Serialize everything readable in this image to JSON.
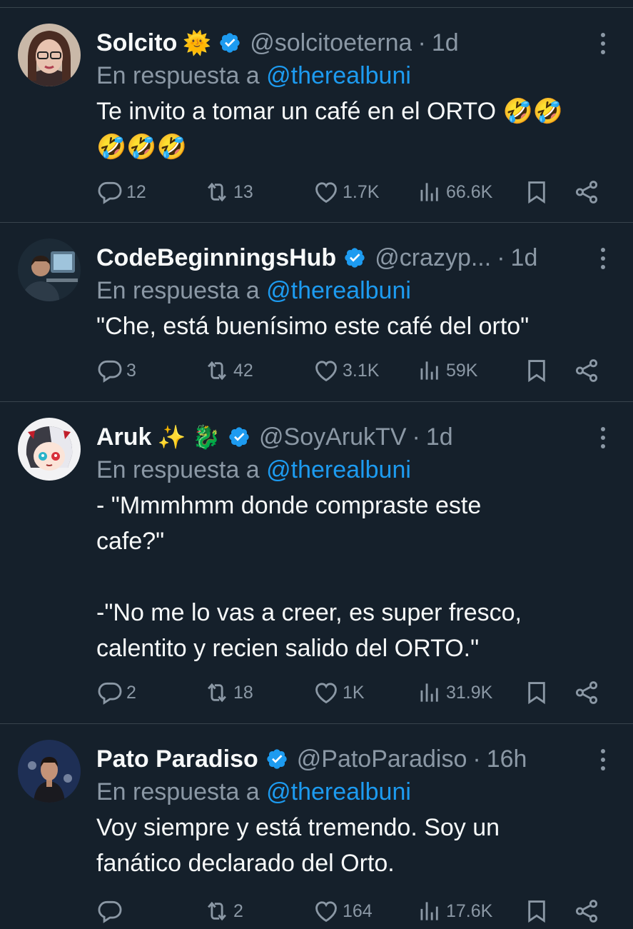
{
  "tweets": [
    {
      "name": "Solcito",
      "emoji": "🌞",
      "handle": "@solcitoeterna",
      "time": "1d",
      "reply_prefix": "En respuesta a ",
      "reply_to": "@therealbuni",
      "text": "Te invito a tomar un café en el ORTO 🤣🤣\n🤣🤣🤣",
      "replies": "12",
      "retweets": "13",
      "likes": "1.7K",
      "views": "66.6K"
    },
    {
      "name": "CodeBeginningsHub",
      "emoji": "",
      "handle": "@crazyp...",
      "time": "1d",
      "reply_prefix": "En respuesta a ",
      "reply_to": "@therealbuni",
      "text": "\"Che, está buenísimo este café del orto\"",
      "replies": "3",
      "retweets": "42",
      "likes": "3.1K",
      "views": "59K"
    },
    {
      "name": "Aruk",
      "emoji": "✨ 🐉",
      "handle": "@SoyArukTV",
      "time": "1d",
      "reply_prefix": "En respuesta a ",
      "reply_to": "@therealbuni",
      "text": "- \"Mmmhmm donde compraste este\ncafe?\"\n\n-\"No me lo vas a creer, es super fresco,\ncalentito y recien salido del ORTO.\"",
      "replies": "2",
      "retweets": "18",
      "likes": "1K",
      "views": "31.9K"
    },
    {
      "name": "Pato Paradiso",
      "emoji": "",
      "handle": "@PatoParadiso",
      "time": "16h",
      "reply_prefix": "En respuesta a ",
      "reply_to": "@therealbuni",
      "text": "Voy siempre y está tremendo. Soy un\nfanático declarado del Orto.",
      "replies": "",
      "retweets": "2",
      "likes": "164",
      "views": "17.6K"
    }
  ],
  "colors": {
    "background": "#15202b",
    "text": "#f7f9f9",
    "muted": "#8b98a5",
    "link": "#1d9bf0",
    "verified": "#1d9bf0",
    "divider": "#38444d"
  },
  "icons": [
    "more-icon",
    "verified-badge-icon",
    "reply-icon",
    "retweet-icon",
    "like-icon",
    "views-icon",
    "bookmark-icon",
    "share-icon"
  ]
}
